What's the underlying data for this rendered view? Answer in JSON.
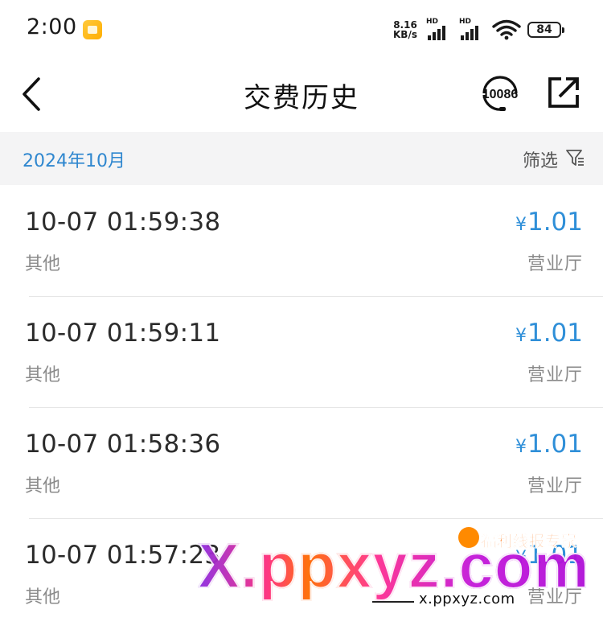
{
  "status_bar": {
    "time": "2:00",
    "net_speed_value": "8.16",
    "net_speed_unit": "KB/s",
    "sim1_label": "HD",
    "sim2_label": "HD",
    "battery": "84"
  },
  "header": {
    "title": "交费历史",
    "service_label": "10086"
  },
  "month_bar": {
    "month": "2024年10月",
    "filter_label": "筛选"
  },
  "records": [
    {
      "time": "10-07 01:59:38",
      "type": "其他",
      "currency": "¥",
      "amount": "1.01",
      "channel": "营业厅"
    },
    {
      "time": "10-07 01:59:11",
      "type": "其他",
      "currency": "¥",
      "amount": "1.01",
      "channel": "营业厅"
    },
    {
      "time": "10-07 01:58:36",
      "type": "其他",
      "currency": "¥",
      "amount": "1.01",
      "channel": "营业厅"
    },
    {
      "time": "10-07 01:57:23",
      "type": "其他",
      "currency": "¥",
      "amount": "1.01",
      "channel": "营业厅"
    }
  ],
  "watermark": {
    "brand_cn": "福利线报专家",
    "big_text": "X.ppxyz.com",
    "url": "x.ppxyz.com"
  },
  "colors": {
    "accent_blue": "#2f8fd8",
    "month_blue": "#2f87cf",
    "section_bg": "#f4f4f5"
  }
}
